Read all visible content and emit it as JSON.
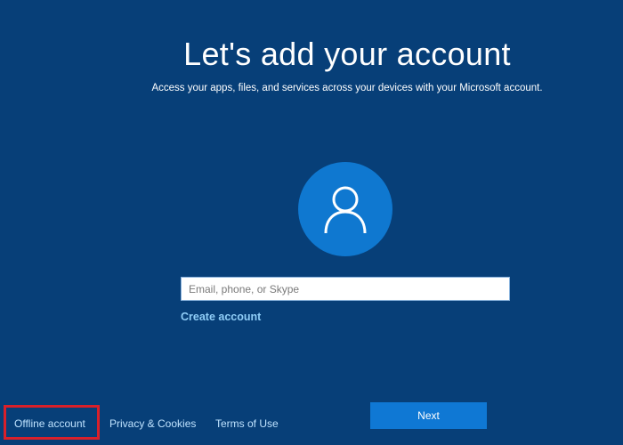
{
  "header": {
    "title": "Let's add your account",
    "subtitle": "Access your apps, files, and services across your devices with your Microsoft account."
  },
  "avatar": {
    "icon": "user-icon"
  },
  "form": {
    "email_placeholder": "Email, phone, or Skype",
    "email_value": "",
    "create_account": "Create account"
  },
  "footer": {
    "offline_account": "Offline account",
    "privacy": "Privacy & Cookies",
    "terms": "Terms of Use",
    "next": "Next"
  },
  "colors": {
    "background": "#073f78",
    "accent": "#0f78d4",
    "highlight": "#d8202a"
  }
}
